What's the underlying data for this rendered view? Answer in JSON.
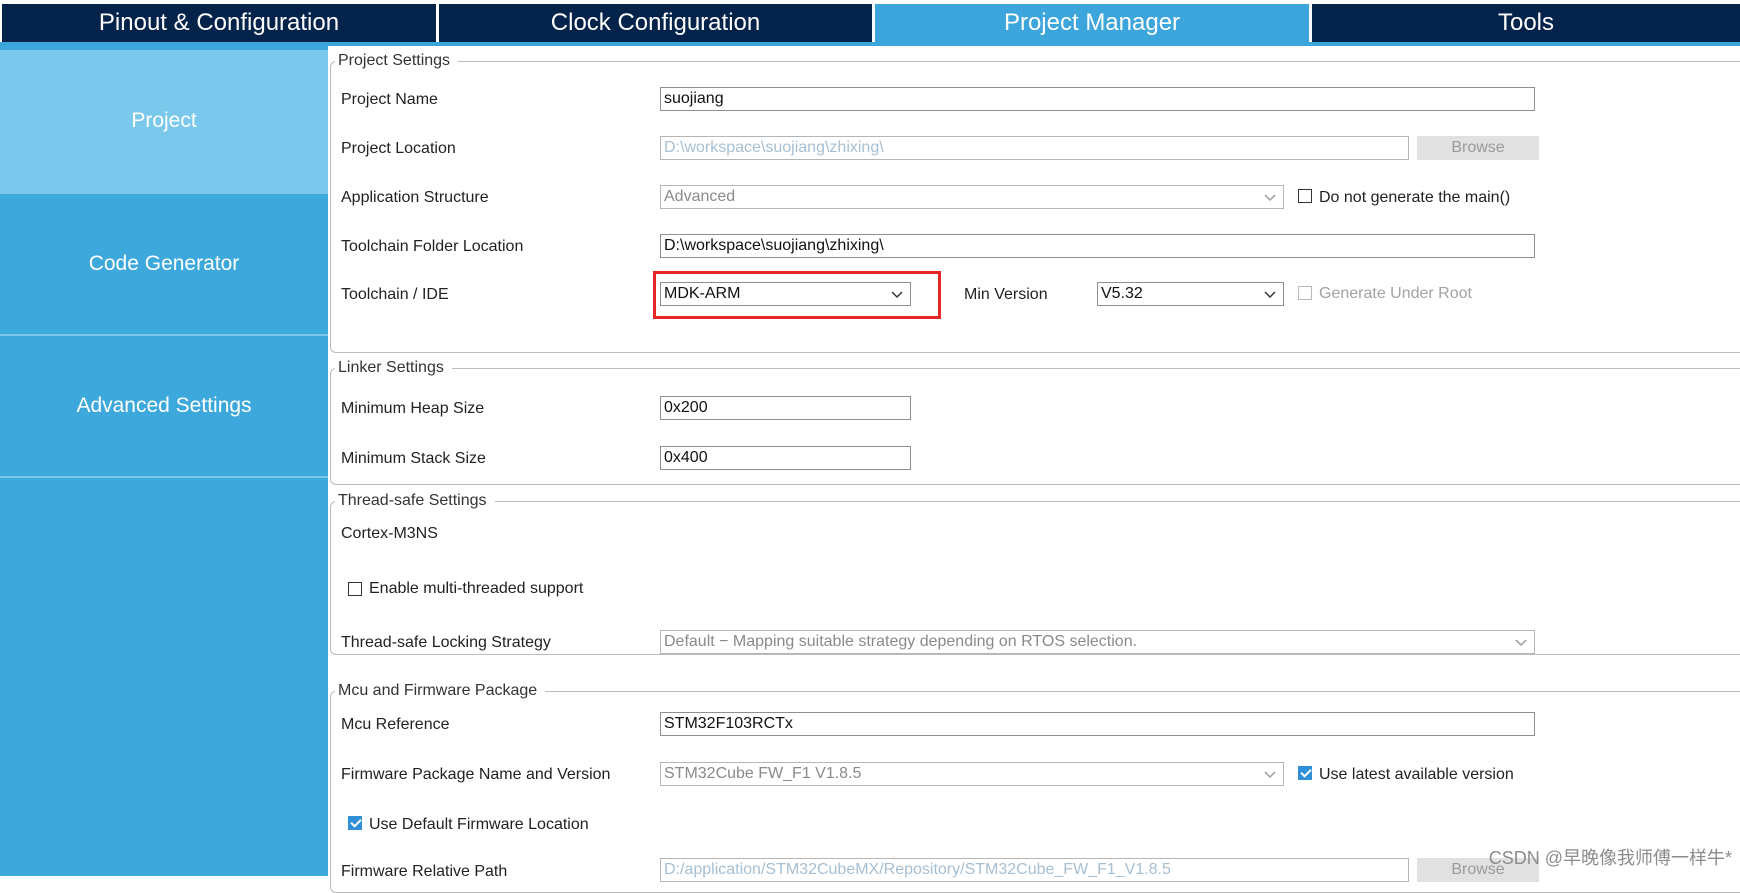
{
  "tabs": [
    {
      "label": "Pinout & Configuration"
    },
    {
      "label": "Clock Configuration"
    },
    {
      "label": "Project Manager"
    },
    {
      "label": "Tools"
    }
  ],
  "sidebar": {
    "items": [
      {
        "label": "Project"
      },
      {
        "label": "Code Generator"
      },
      {
        "label": "Advanced Settings"
      }
    ]
  },
  "project_settings": {
    "title": "Project Settings",
    "project_name_label": "Project Name",
    "project_name_value": "suojiang",
    "project_location_label": "Project Location",
    "project_location_value": "D:\\workspace\\suojiang\\zhixing\\",
    "browse_label": "Browse",
    "app_structure_label": "Application Structure",
    "app_structure_value": "Advanced",
    "no_main_label": "Do not generate the main()",
    "toolchain_folder_label": "Toolchain Folder Location",
    "toolchain_folder_value": "D:\\workspace\\suojiang\\zhixing\\",
    "toolchain_ide_label": "Toolchain / IDE",
    "toolchain_ide_value": "MDK-ARM",
    "min_version_label": "Min Version",
    "min_version_value": "V5.32",
    "generate_under_root_label": "Generate Under Root"
  },
  "linker_settings": {
    "title": "Linker Settings",
    "heap_label": "Minimum Heap Size",
    "heap_value": "0x200",
    "stack_label": "Minimum Stack Size",
    "stack_value": "0x400"
  },
  "thread_safe": {
    "title": "Thread-safe Settings",
    "core": "Cortex-M3NS",
    "multithread_label": "Enable multi-threaded support",
    "locking_label": "Thread-safe Locking Strategy",
    "locking_value": "Default  −  Mapping suitable strategy depending on RTOS selection."
  },
  "mcu_firmware": {
    "title": "Mcu and Firmware Package",
    "mcu_ref_label": "Mcu Reference",
    "mcu_ref_value": "STM32F103RCTx",
    "fw_label": "Firmware Package Name and Version",
    "fw_value": "STM32Cube FW_F1 V1.8.5",
    "use_latest_label": "Use latest available version",
    "use_default_label": "Use Default Firmware Location",
    "fw_path_label": "Firmware Relative Path",
    "fw_path_value": "D:/application/STM32CubeMX/Repository/STM32Cube_FW_F1_V1.8.5",
    "browse_label": "Browse"
  },
  "watermark": "CSDN @早晚像我师傅一样牛*",
  "colors": {
    "tab_bg": "#03234b",
    "tab_active": "#3ca5dc",
    "sidebar": "#3da8dc",
    "sidebar_active": "#7ac8eb",
    "highlight": "#e52626",
    "checkbox_checked": "#2f8fd8"
  }
}
